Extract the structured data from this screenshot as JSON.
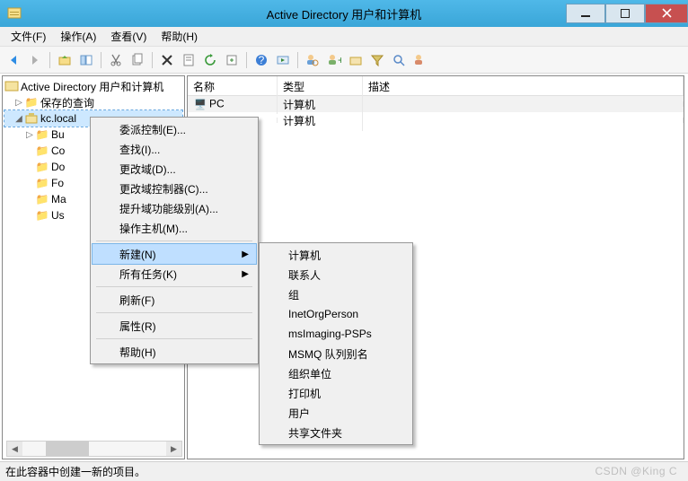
{
  "window": {
    "title": "Active Directory 用户和计算机"
  },
  "menubar": [
    "文件(F)",
    "操作(A)",
    "查看(V)",
    "帮助(H)"
  ],
  "tree": {
    "root": "Active Directory 用户和计算机",
    "savedQueries": "保存的查询",
    "domain": "kc.local",
    "children": [
      "Bu",
      "Co",
      "Do",
      "Fo",
      "Ma",
      "Us"
    ]
  },
  "list": {
    "columns": [
      "名称",
      "类型",
      "描述"
    ],
    "rows": [
      {
        "name": "PC",
        "type": "计算机",
        "desc": ""
      },
      {
        "name": "",
        "type": "计算机",
        "desc": ""
      }
    ]
  },
  "context_menu": {
    "items": [
      "委派控制(E)...",
      "查找(I)...",
      "更改域(D)...",
      "更改域控制器(C)...",
      "提升域功能级别(A)...",
      "操作主机(M)..."
    ],
    "new_label": "新建(N)",
    "alltasks_label": "所有任务(K)",
    "refresh": "刷新(F)",
    "properties": "属性(R)",
    "help": "帮助(H)"
  },
  "submenu": [
    "计算机",
    "联系人",
    "组",
    "InetOrgPerson",
    "msImaging-PSPs",
    "MSMQ 队列别名",
    "组织单位",
    "打印机",
    "用户",
    "共享文件夹"
  ],
  "status": "在此容器中创建一新的项目。",
  "watermark": "CSDN @King C"
}
